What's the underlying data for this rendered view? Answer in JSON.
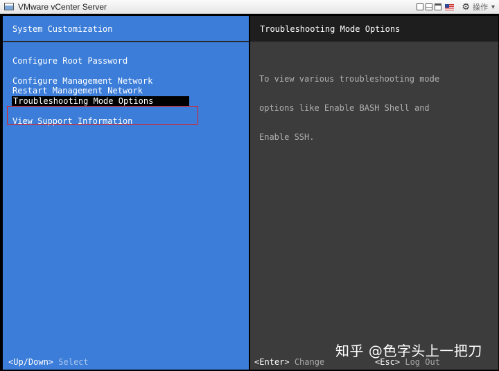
{
  "window": {
    "title": "VMware vCenter Server",
    "action_menu_label": "操作"
  },
  "left_panel": {
    "title": "System Customization",
    "items": [
      {
        "label": "Configure Root Password",
        "selected": false
      },
      {
        "label": "Configure Management Network",
        "selected": false
      },
      {
        "label": "Restart Management Network",
        "selected": false
      },
      {
        "label": "Troubleshooting Mode Options",
        "selected": true
      },
      {
        "label": "View Support Information",
        "selected": false
      }
    ],
    "footer": {
      "key": "<Up/Down>",
      "action": "Select"
    }
  },
  "right_panel": {
    "title": "Troubleshooting Mode Options",
    "description_lines": [
      "To view various troubleshooting mode",
      "options like Enable BASH Shell and",
      "Enable SSH."
    ],
    "footer": [
      {
        "key": "<Enter>",
        "action": "Change"
      },
      {
        "key": "<Esc>",
        "action": "Log Out"
      }
    ]
  },
  "watermark": "知乎 @色字头上一把刀",
  "colors": {
    "left_panel_bg": "#3b7dd8",
    "right_panel_bg": "#3c3c3c",
    "selection_bg": "#000000",
    "highlight_border": "#e02020"
  },
  "icons": [
    "vmware-console-icon",
    "window-minimize-icon",
    "window-restore-icon",
    "window-maximize-icon",
    "us-flag-icon",
    "gear-icon",
    "chevron-down-icon"
  ]
}
